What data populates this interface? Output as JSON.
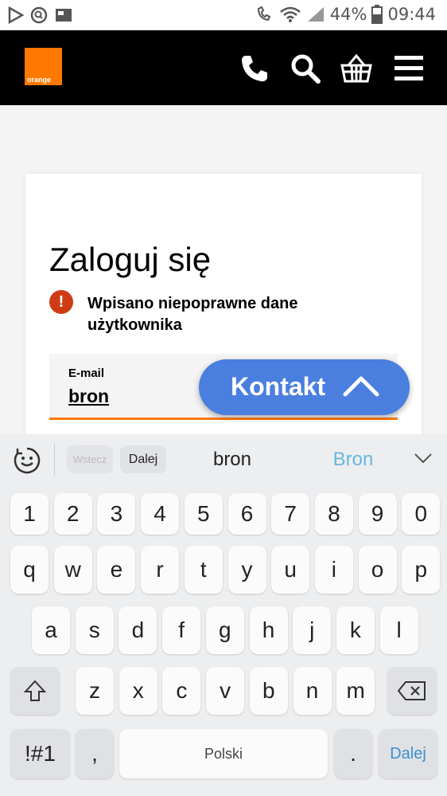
{
  "status_bar": {
    "battery": "44%",
    "time": "09:44"
  },
  "header": {
    "logo_text": "orange",
    "brand_color": "#ff7900"
  },
  "login": {
    "title": "Zaloguj się",
    "error_line1": "Wpisano niepoprawne dane",
    "error_line2": "użytkownika",
    "email_label": "E-mail",
    "email_value": "bron"
  },
  "kontakt_button": {
    "label": "Kontakt",
    "color": "#4a7fe0"
  },
  "keyboard": {
    "wstecz_label": "Wstecz",
    "dalej_small_label": "Dalej",
    "suggestion_1": "bron",
    "suggestion_2": "Bron",
    "row_numbers": [
      "1",
      "2",
      "3",
      "4",
      "5",
      "6",
      "7",
      "8",
      "9",
      "0"
    ],
    "row_1": [
      "q",
      "w",
      "e",
      "r",
      "t",
      "y",
      "u",
      "i",
      "o",
      "p"
    ],
    "row_2": [
      "a",
      "s",
      "d",
      "f",
      "g",
      "h",
      "j",
      "k",
      "l"
    ],
    "row_3": [
      "z",
      "x",
      "c",
      "v",
      "b",
      "n",
      "m"
    ],
    "symbols_label": "!#1",
    "comma_label": ",",
    "space_label": "Polski",
    "period_label": ".",
    "enter_label": "Dalej"
  }
}
